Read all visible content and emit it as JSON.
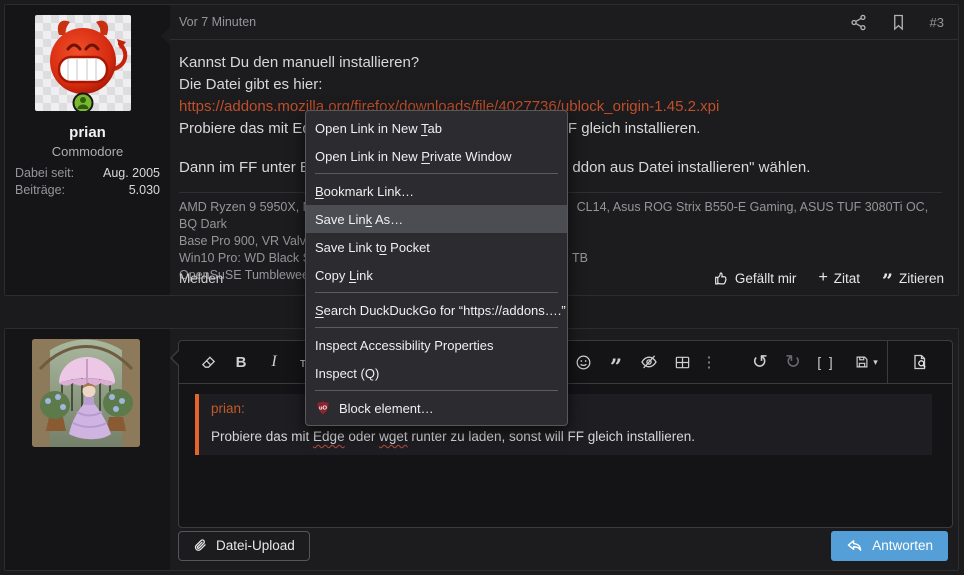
{
  "post": {
    "header": {
      "time": "Vor 7 Minuten",
      "number": "#3"
    },
    "author": {
      "name": "prian",
      "rank": "Commodore",
      "joined_label": "Dabei seit:",
      "joined_value": "Aug. 2005",
      "posts_label": "Beiträge:",
      "posts_value": "5.030"
    },
    "body": {
      "line1": "Kannst Du den manuell installieren?",
      "line2": "Die Datei gibt es hier:",
      "link": "https://addons.mozilla.org/firefox/downloads/file/4027736/ublock_origin-1.45.2.xpi",
      "line3_left": "Probiere das mit Ed",
      "line3_right": "FF gleich installieren.",
      "line4_left": "Dann im FF unter Ex",
      "line4_right": "ddon aus Datei installieren\" wählen."
    },
    "signature": {
      "line1_left": "AMD Ryzen 9 5950X, No",
      "line1_right": "CL14, Asus ROG Strix B550-E Gaming, ASUS TUF 3080Ti OC, BQ Dark",
      "line2": "Base Pro 900, VR Valve In",
      "line3_left": "Win10 Pro: WD Black SN",
      "line3_right": "TB",
      "line4": "OpenSuSE Tumbleweed:"
    },
    "footer": {
      "report": "Melden",
      "like": "Gefällt mir",
      "add_quote_plus": "+",
      "add_quote": "Zitat",
      "quote_glyph": "”",
      "quote": "Zitieren"
    }
  },
  "context_menu": {
    "items": [
      {
        "pre": "Open Link in New ",
        "key": "T",
        "post": "ab"
      },
      {
        "pre": "Open Link in New ",
        "key": "P",
        "post": "rivate Window"
      },
      {
        "pre": "",
        "key": "B",
        "post": "ookmark Link…"
      },
      {
        "pre": "Save Lin",
        "key": "k",
        "post": " As…"
      },
      {
        "pre": "Save Link t",
        "key": "o",
        "post": " Pocket"
      },
      {
        "pre": "Copy ",
        "key": "L",
        "post": "ink"
      },
      {
        "pre": "",
        "key": "S",
        "post": "earch DuckDuckGo for “https://addons….”"
      },
      {
        "pre": "Inspect Accessibility Properties",
        "key": "",
        "post": ""
      },
      {
        "pre": "Inspect (Q)",
        "key": "",
        "post": ""
      },
      {
        "pre": "Block element…",
        "key": "",
        "post": ""
      }
    ],
    "highlighted_item": "Save Link As…"
  },
  "reply": {
    "toolbar": {
      "bold_label": "B",
      "italic_label": "I",
      "fontsize_label": "тT",
      "quote_glyph": "”",
      "more_glyph": "⋮",
      "undo_glyph": "↺",
      "redo_glyph": "↻",
      "source_label": "[ ]",
      "caret_glyph": "▾"
    },
    "quote": {
      "author": "prian:",
      "text_pre": "Probiere das mit ",
      "word1": "Edge",
      "text_mid": " oder ",
      "word2": "wget",
      "text_post": " runter zu laden, sonst will FF gleich installieren."
    },
    "upload_button": "Datei-Upload",
    "reply_button": "Antworten"
  }
}
